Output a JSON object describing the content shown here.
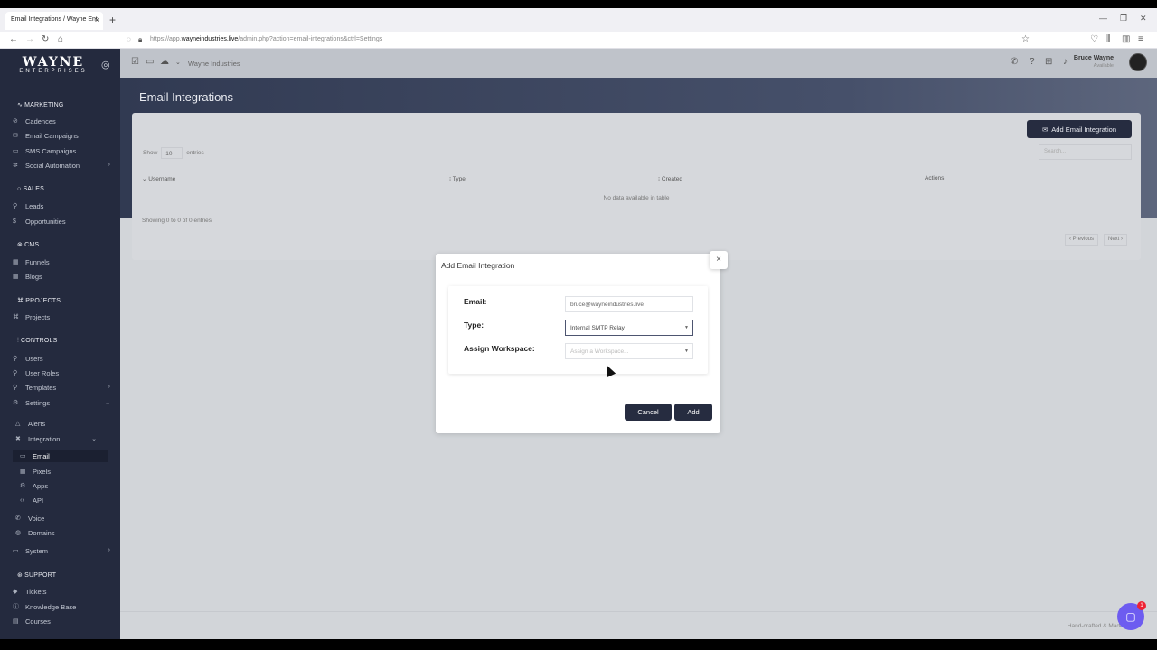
{
  "browser": {
    "tab_title": "Email Integrations / Wayne Ent",
    "tab_close": "×",
    "new_tab": "+",
    "url_prefix": "https://app.",
    "url_domain": "wayneindustries.live",
    "url_path": "/admin.php?action=email-integrations&ctrl=Settings"
  },
  "sidebar": {
    "logo_main": "WAYNE",
    "logo_sub": "ENTERPRISES",
    "sections": {
      "marketing": "MARKETING",
      "sales": "SALES",
      "cms": "CMS",
      "projects": "PROJECTS",
      "controls": "CONTROLS",
      "support": "SUPPORT"
    },
    "items": {
      "cadences": "Cadences",
      "email_campaigns": "Email Campaigns",
      "sms_campaigns": "SMS Campaigns",
      "social_automation": "Social Automation",
      "leads": "Leads",
      "opportunities": "Opportunities",
      "funnels": "Funnels",
      "blogs": "Blogs",
      "projects": "Projects",
      "users": "Users",
      "user_roles": "User Roles",
      "templates": "Templates",
      "settings": "Settings",
      "alerts": "Alerts",
      "integration": "Integration",
      "email": "Email",
      "pixels": "Pixels",
      "apps": "Apps",
      "api": "API",
      "voice": "Voice",
      "domains": "Domains",
      "system": "System",
      "tickets": "Tickets",
      "knowledge_base": "Knowledge Base",
      "courses": "Courses"
    }
  },
  "header": {
    "breadcrumb": "Wayne Industries",
    "user_name": "Bruce Wayne",
    "user_status": "Available"
  },
  "page": {
    "title": "Email Integrations",
    "add_button": "Add Email Integration",
    "show_label": "Show",
    "entries_label": "entries",
    "page_size": "10",
    "search_placeholder": "Search...",
    "columns": [
      "Username",
      "Type",
      "Created",
      "Actions"
    ],
    "empty_text": "No data available in table",
    "info_text": "Showing 0 to 0 of 0 entries",
    "prev_label": "‹ Previous",
    "next_label": "Next ›",
    "footer_text": "Hand-crafted & Made with"
  },
  "modal": {
    "title": "Add Email Integration",
    "close": "×",
    "email_label": "Email:",
    "email_value": "bruce@wayneindustries.live",
    "type_label": "Type:",
    "type_value": "Internal SMTP Relay",
    "workspace_label": "Assign Workspace:",
    "workspace_placeholder": "Assign a Workspace...",
    "cancel_label": "Cancel",
    "add_label": "Add"
  },
  "chat": {
    "badge": "1"
  }
}
